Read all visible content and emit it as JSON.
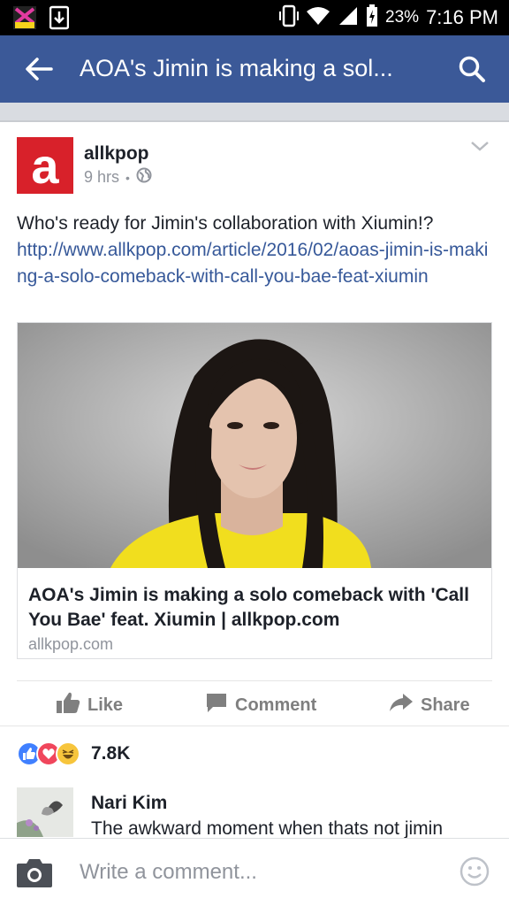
{
  "status_bar": {
    "battery_percent": "23%",
    "time": "7:16 PM",
    "icons": [
      "app-notification-icon",
      "download-icon",
      "vibrate-icon",
      "wifi-icon",
      "signal-icon",
      "battery-charging-icon"
    ]
  },
  "app_bar": {
    "title": "AOA's Jimin is making a sol...",
    "back_icon": "arrow-left-icon",
    "search_icon": "search-icon",
    "color": "#3b5998"
  },
  "post": {
    "page_name": "allkpop",
    "avatar_letter": "a",
    "time_ago": "9 hrs",
    "separator": "•",
    "text": "Who's ready for Jimin's collaboration with Xiumin!?",
    "link": "http://www.allkpop.com/article/2016/02/aoas-jimin-is-making-a-solo-comeback-with-call-you-bae-feat-xiumin",
    "card": {
      "title": "AOA's Jimin is making a solo comeback with 'Call You Bae' feat. Xiumin | allkpop.com",
      "domain": "allkpop.com"
    }
  },
  "actions": {
    "like": "Like",
    "comment": "Comment",
    "share": "Share"
  },
  "reactions": {
    "count": "7.8K",
    "types": [
      "like",
      "love",
      "haha"
    ]
  },
  "comment": {
    "author": "Nari Kim",
    "text": "The awkward moment when thats not jimin"
  },
  "composer": {
    "placeholder": "Write a comment..."
  }
}
